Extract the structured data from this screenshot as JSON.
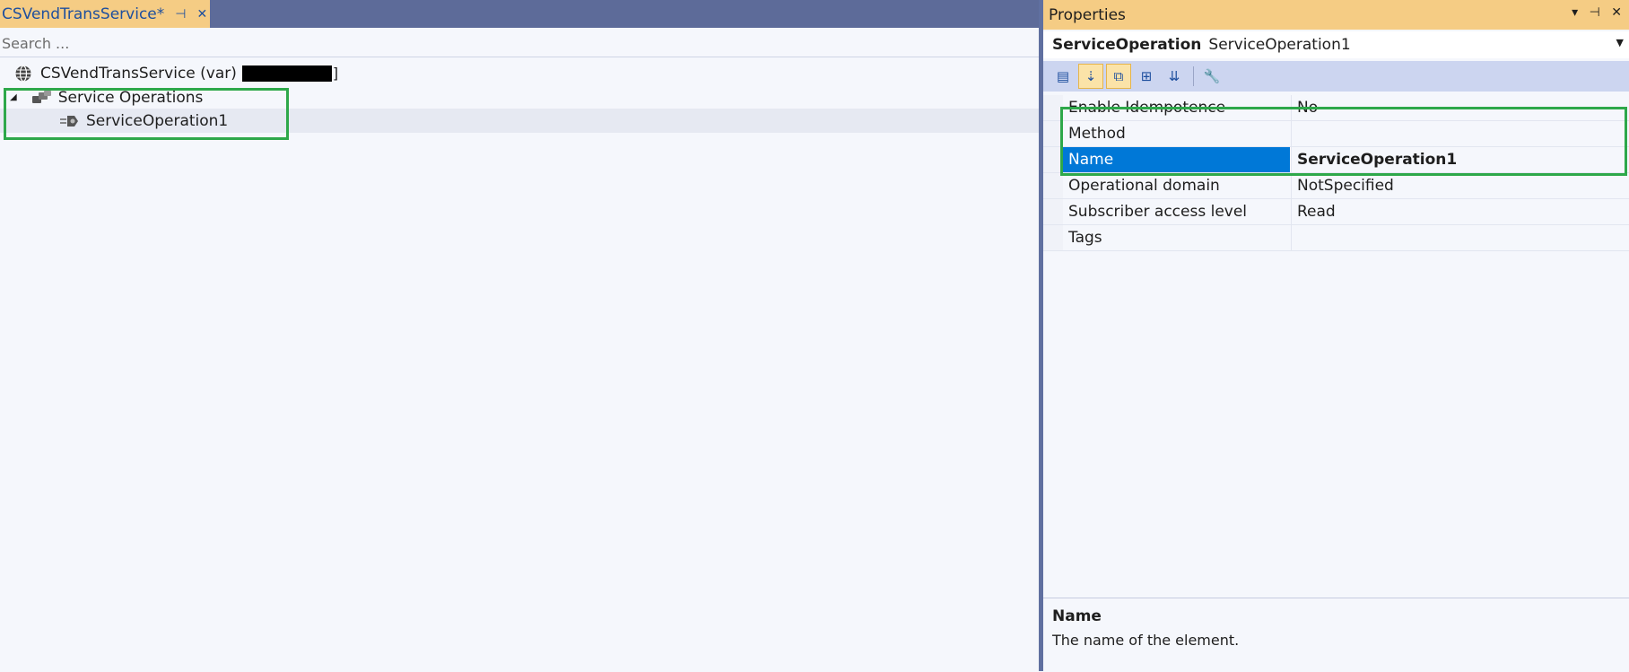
{
  "document_tab": {
    "title": "CSVendTransService*",
    "pin": "⊣",
    "close": "✕"
  },
  "search": {
    "placeholder": "Search ..."
  },
  "tree": {
    "root_label": "CSVendTransService (var)",
    "root_suffix": "]",
    "group_label": "Service Operations",
    "item_label": "ServiceOperation1"
  },
  "properties": {
    "title": "Properties",
    "header_buttons": "▾ ⊣ ✕",
    "object_type": "ServiceOperation",
    "object_name": "ServiceOperation1",
    "rows": [
      {
        "name": "Enable Idempotence",
        "value": "No"
      },
      {
        "name": "Method",
        "value": ""
      },
      {
        "name": "Name",
        "value": "ServiceOperation1"
      },
      {
        "name": "Operational domain",
        "value": "NotSpecified"
      },
      {
        "name": "Subscriber access level",
        "value": "Read"
      },
      {
        "name": "Tags",
        "value": ""
      }
    ],
    "selected_row": "Name",
    "description_name": "Name",
    "description_text": "The name of the element."
  },
  "colors": {
    "accent_tab": "#f5cc84",
    "tabbar": "#5d6b99",
    "selection": "#0078d7",
    "highlight_box": "#2ea84a"
  }
}
